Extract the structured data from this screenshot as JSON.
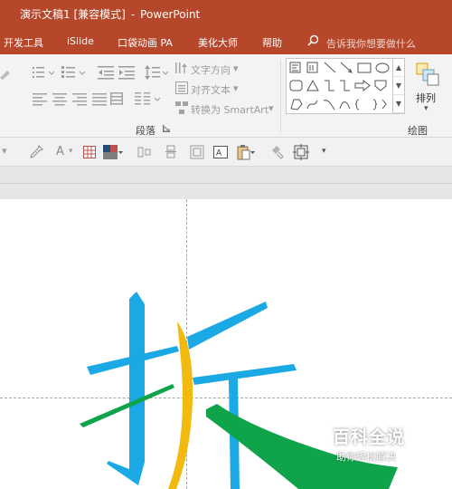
{
  "window": {
    "doc_title": "演示文稿1 [兼容模式]",
    "separator": "-",
    "app_name": "PowerPoint"
  },
  "menu": {
    "items": [
      "开发工具",
      "iSlide",
      "口袋动画 PA",
      "美化大师",
      "帮助"
    ],
    "tell_me_placeholder": "告诉我你想要做什么"
  },
  "ribbon": {
    "paragraph": {
      "text_direction": "文字方向",
      "align_text": "对齐文本",
      "convert_smartart": "转换为 SmartArt",
      "group_label": "段落"
    },
    "drawing": {
      "group_label": "绘图",
      "arrange_label": "排列"
    }
  },
  "slide": {
    "character": "拆"
  },
  "watermark": {
    "title": "百科全说",
    "subtitle": "助你轻松解决"
  },
  "colors": {
    "titlebar": "#b7472a",
    "stroke_blue": "#1aa9e4",
    "stroke_green": "#0fa34a",
    "stroke_yellow": "#f2b90f"
  }
}
